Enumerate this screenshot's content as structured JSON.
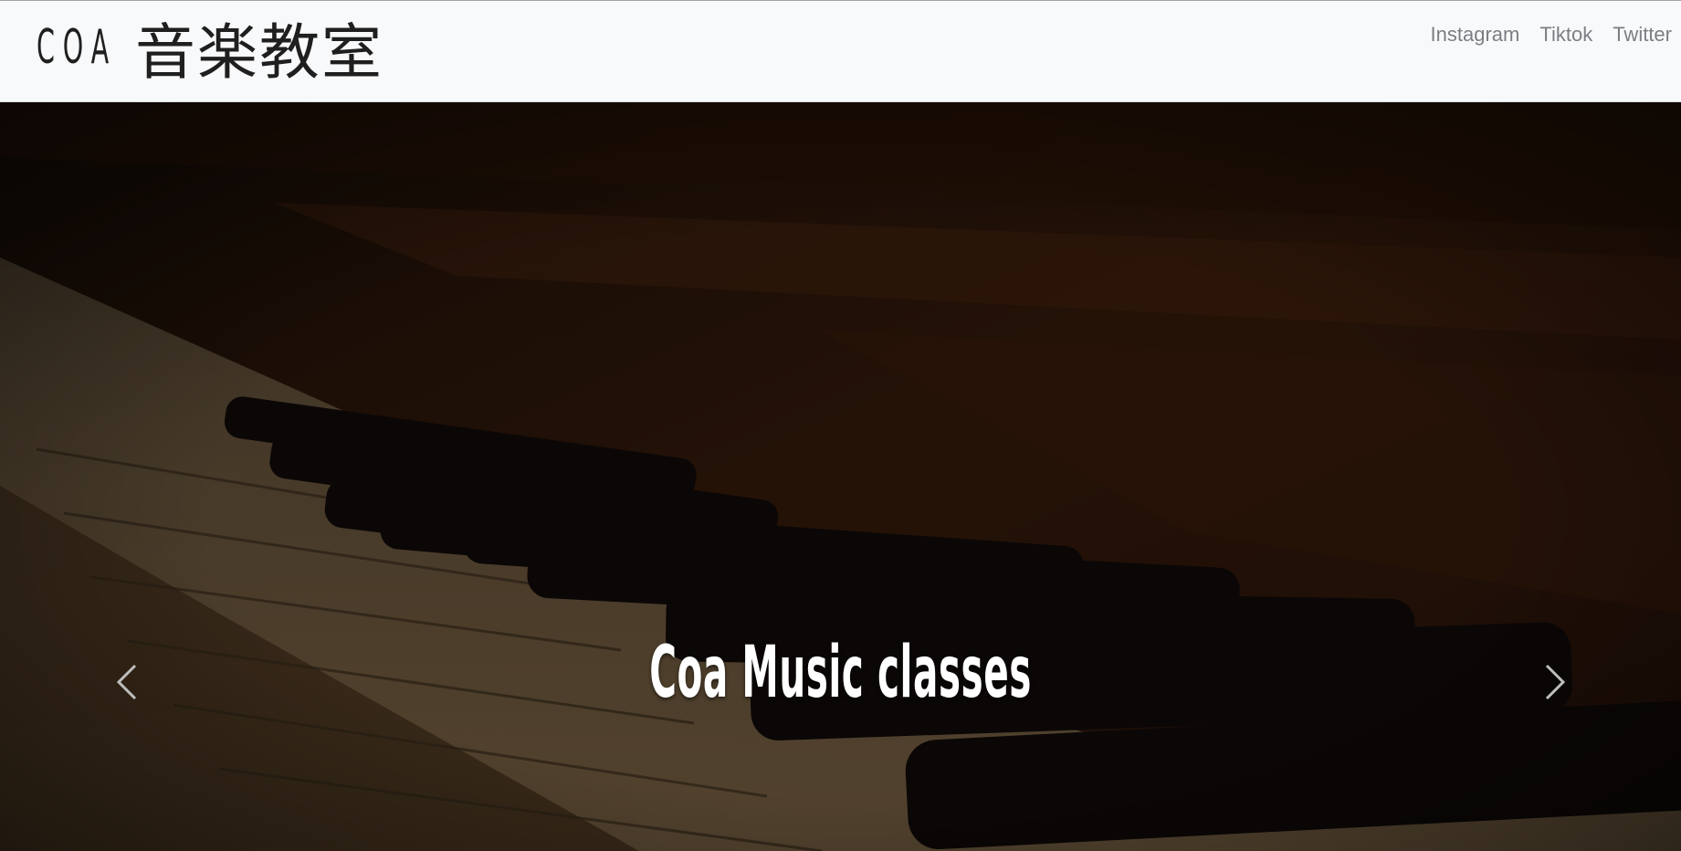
{
  "navbar": {
    "brand_latin": "COA",
    "brand_jp": "音楽教室",
    "links": [
      {
        "label": "Instagram"
      },
      {
        "label": "Tiktok"
      },
      {
        "label": "Twitter"
      }
    ]
  },
  "hero": {
    "caption": "Coa Music classes",
    "prev_icon": "chevron-left-icon",
    "next_icon": "chevron-right-icon"
  },
  "colors": {
    "navbar_bg": "#f8f9fa",
    "nav_link": "#7a7f84",
    "caption": "#ffffff"
  }
}
